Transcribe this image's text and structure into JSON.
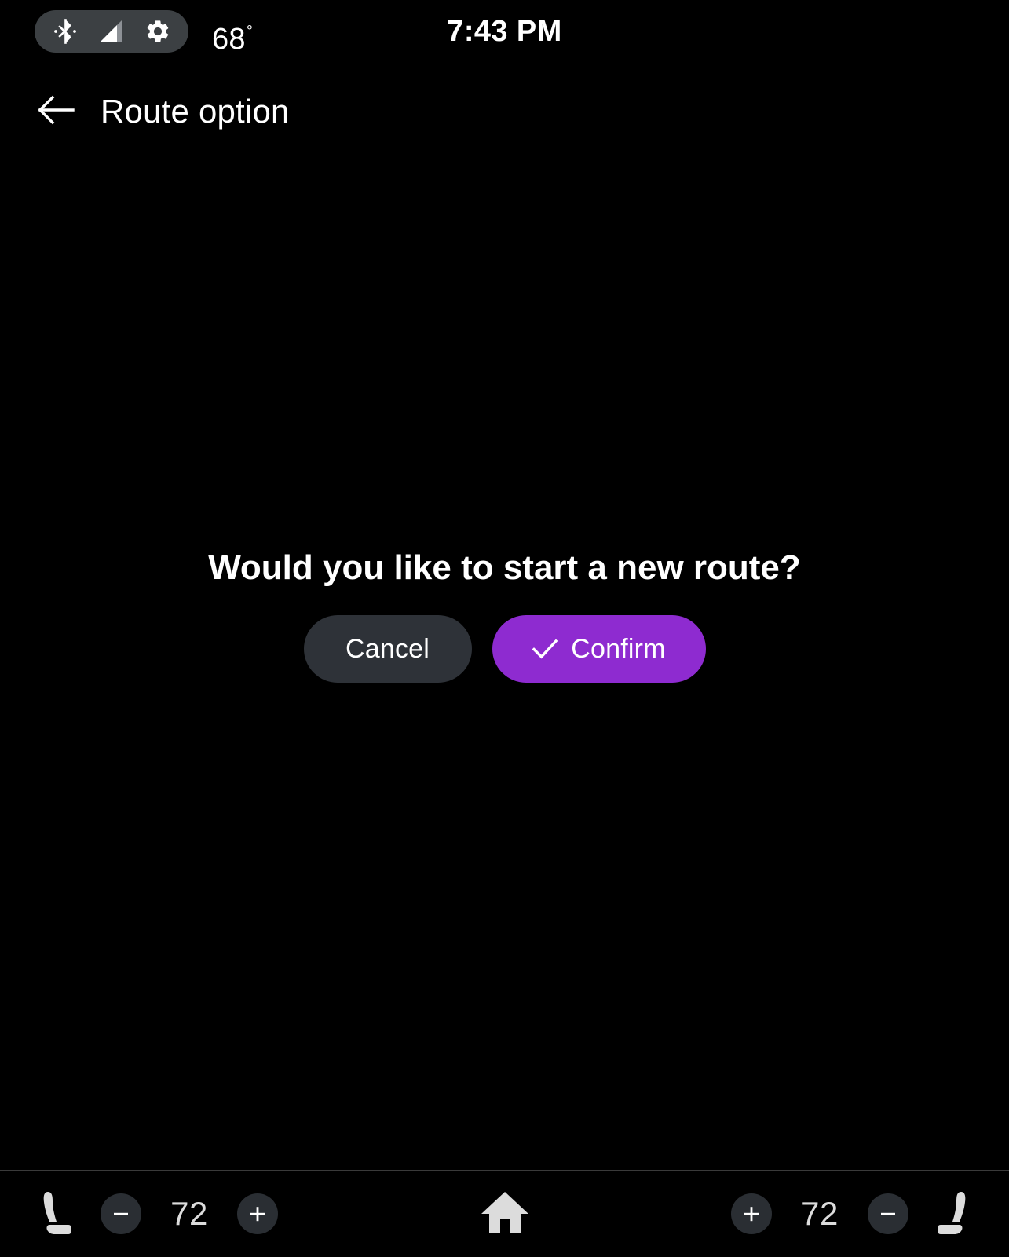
{
  "status_bar": {
    "icons": [
      {
        "name": "bluetooth-icon"
      },
      {
        "name": "cellular-signal-icon"
      },
      {
        "name": "settings-gear-icon"
      }
    ],
    "outside_temperature": "68",
    "degree_symbol": "°",
    "clock": "7:43 PM",
    "pill_color": "#3C4043"
  },
  "header": {
    "back_icon": "arrow-back-icon",
    "title": "Route option"
  },
  "dialog": {
    "message": "Would you like to start a new route?",
    "cancel_label": "Cancel",
    "confirm_label": "Confirm",
    "confirm_icon": "check-icon",
    "cancel_color": "#2E3238",
    "confirm_color": "#8E2BD0"
  },
  "bottom_bar": {
    "driver_climate": {
      "seat_icon": "car-seat-icon",
      "decrease_label": "−",
      "temperature": "72",
      "increase_label": "+"
    },
    "passenger_climate": {
      "increase_label": "+",
      "temperature": "72",
      "decrease_label": "−",
      "seat_icon": "car-seat-icon"
    },
    "home_icon": "home-icon",
    "circle_color": "#2A2E33",
    "icon_color": "#DCDCDC"
  }
}
